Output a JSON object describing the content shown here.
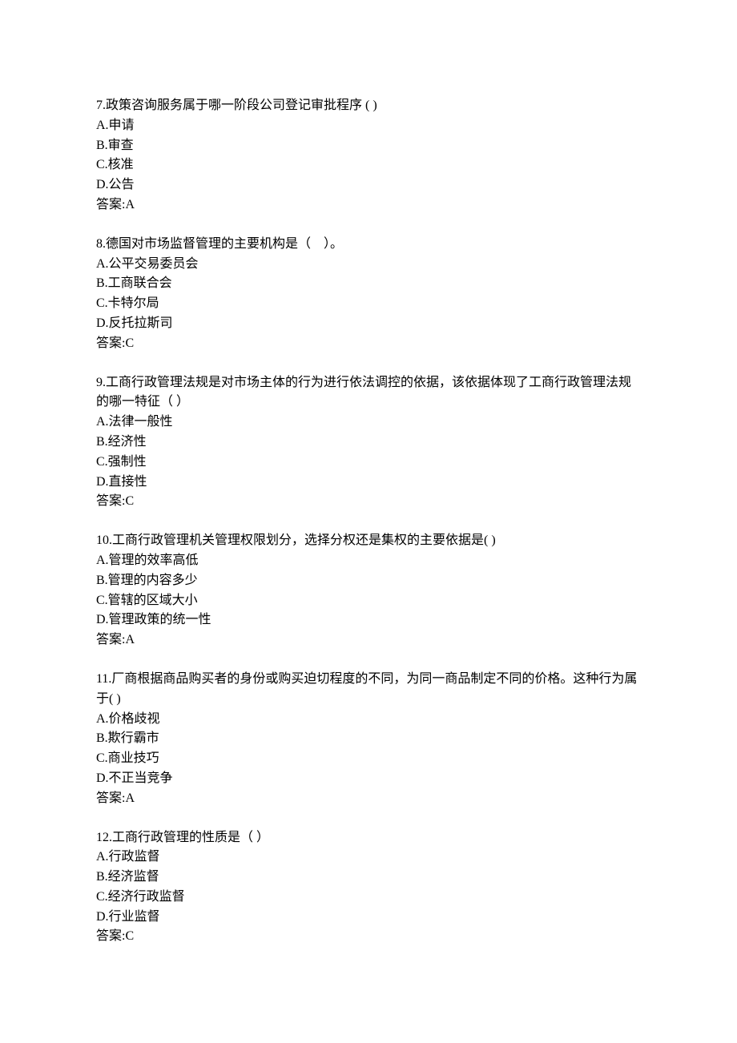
{
  "questions": [
    {
      "number": "7",
      "text": "7.政策咨询服务属于哪一阶段公司登记审批程序 ( )",
      "options": [
        "A.申请",
        "B.审查",
        "C.核准",
        "D.公告"
      ],
      "answer": "答案:A"
    },
    {
      "number": "8",
      "text": "8.德国对市场监督管理的主要机构是（　）。",
      "options": [
        "A.公平交易委员会",
        "B.工商联合会",
        "C.卡特尔局",
        "D.反托拉斯司"
      ],
      "answer": "答案:C"
    },
    {
      "number": "9",
      "text": "9.工商行政管理法规是对市场主体的行为进行依法调控的依据，该依据体现了工商行政管理法规的哪一特征（ ）",
      "options": [
        "A.法律一般性",
        "B.经济性",
        "C.强制性",
        "D.直接性"
      ],
      "answer": "答案:C"
    },
    {
      "number": "10",
      "text": "10.工商行政管理机关管理权限划分，选择分权还是集权的主要依据是( )",
      "options": [
        "A.管理的效率高低",
        "B.管理的内容多少",
        "C.管辖的区域大小",
        "D.管理政策的统一性"
      ],
      "answer": "答案:A"
    },
    {
      "number": "11",
      "text": "11.厂商根据商品购买者的身份或购买迫切程度的不同，为同一商品制定不同的价格。这种行为属于( )",
      "options": [
        "A.价格歧视",
        "B.欺行霸市",
        "C.商业技巧",
        "D.不正当竞争"
      ],
      "answer": "答案:A"
    },
    {
      "number": "12",
      "text": "12.工商行政管理的性质是（ ）",
      "options": [
        "A.行政监督",
        "B.经济监督",
        "C.经济行政监督",
        "D.行业监督"
      ],
      "answer": "答案:C"
    }
  ]
}
